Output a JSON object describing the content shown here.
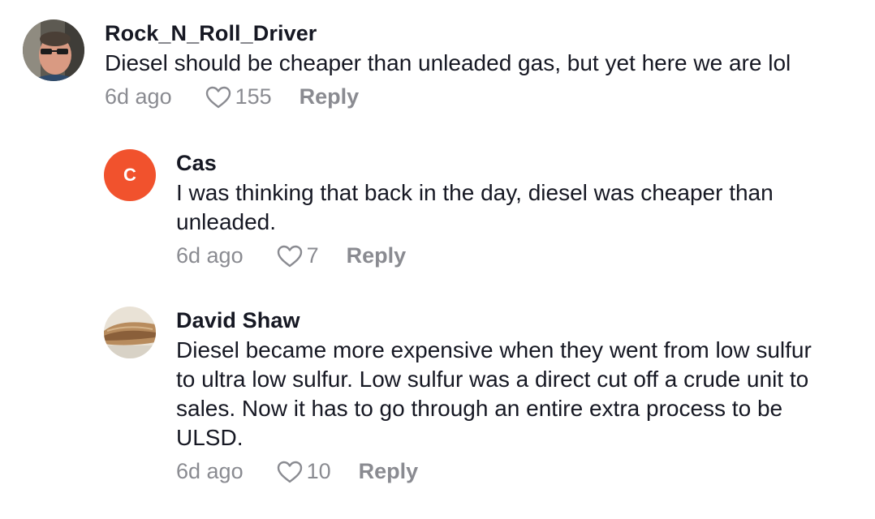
{
  "comments": [
    {
      "username": "Rock_N_Roll_Driver",
      "text": "Diesel should be cheaper than unleaded gas, but yet here we are lol",
      "time": "6d ago",
      "likes": "155",
      "reply_label": "Reply"
    },
    {
      "username": "Cas",
      "avatar_letter": "C",
      "avatar_color": "#f1522d",
      "text_lines": [
        "I was thinking that back in the day, diesel was cheaper than",
        "unleaded."
      ],
      "time": "6d ago",
      "likes": "7",
      "reply_label": "Reply"
    },
    {
      "username": "David Shaw",
      "text_lines": [
        "Diesel became more expensive when they went from low sulfur",
        "to ultra low sulfur. Low sulfur was a direct cut off a crude unit to",
        "sales. Now it has to go through an entire extra process to be",
        "ULSD."
      ],
      "time": "6d ago",
      "likes": "10",
      "reply_label": "Reply"
    }
  ],
  "icons": {
    "like": "heart-outline-icon"
  }
}
